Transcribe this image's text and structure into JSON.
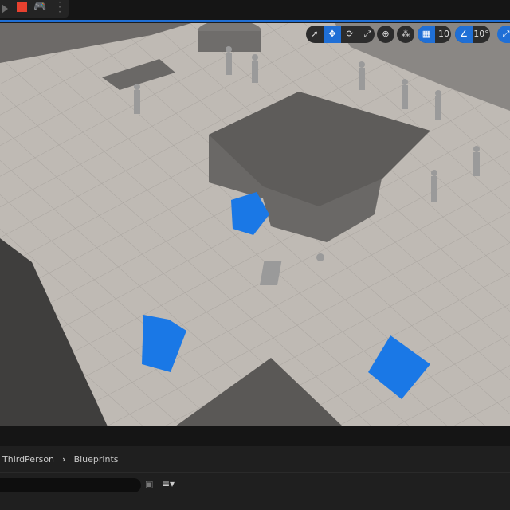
{
  "toolbar": {
    "icons": [
      "play-icon",
      "stop-icon",
      "gamepad-icon",
      "more-icon"
    ],
    "stop_color": "#e8412f"
  },
  "viewport_toolbar": {
    "grid_snap_value": "10",
    "rotation_snap_value": "10°",
    "accent": "#1f6fd6",
    "icons": [
      "select-icon",
      "translate-icon",
      "rotate-icon",
      "scale-icon",
      "world-icon",
      "surface-snap-icon",
      "grid-icon",
      "angle-icon",
      "scale-snap-icon"
    ]
  },
  "breadcrumb": {
    "items": [
      "ThirdPerson",
      "Blueprints"
    ],
    "separator": "›"
  },
  "search": {
    "value": "",
    "placeholder": ""
  }
}
